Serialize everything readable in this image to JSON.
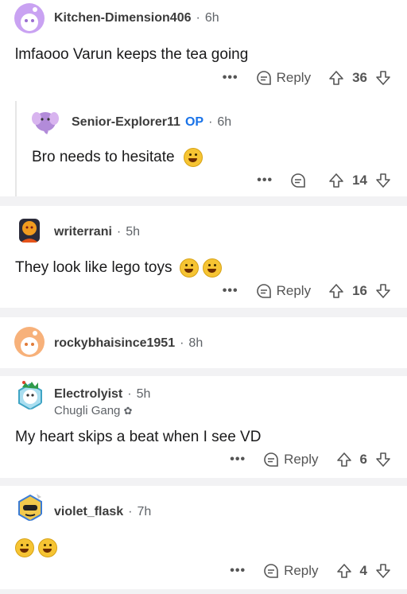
{
  "labels": {
    "reply": "Reply",
    "op": "OP"
  },
  "comments": [
    {
      "user": "Kitchen-Dimension406",
      "time": "6h",
      "text": "lmfaooo Varun keeps the tea going",
      "votes": "36",
      "avatar_color": "#c9a2f2"
    },
    {
      "user": "Senior-Explorer11",
      "time": "6h",
      "text": "Bro needs to hesitate",
      "votes": "14",
      "avatar_color": "#b28bd9"
    },
    {
      "user": "writerrani",
      "time": "5h",
      "text": "They look like lego toys",
      "votes": "16",
      "avatar_color": "#f5d36b"
    },
    {
      "user": "rockybhaisince1951",
      "time": "8h",
      "avatar_color": "#f7b17a"
    },
    {
      "user": "Electrolyist",
      "time": "5h",
      "flair": "Chugli Gang",
      "text": "My heart skips a beat when I see VD",
      "votes": "6",
      "avatar_color": "#7fc7d9"
    },
    {
      "user": "violet_flask",
      "time": "7h",
      "votes": "4",
      "avatar_color": "#e6c34a"
    }
  ]
}
